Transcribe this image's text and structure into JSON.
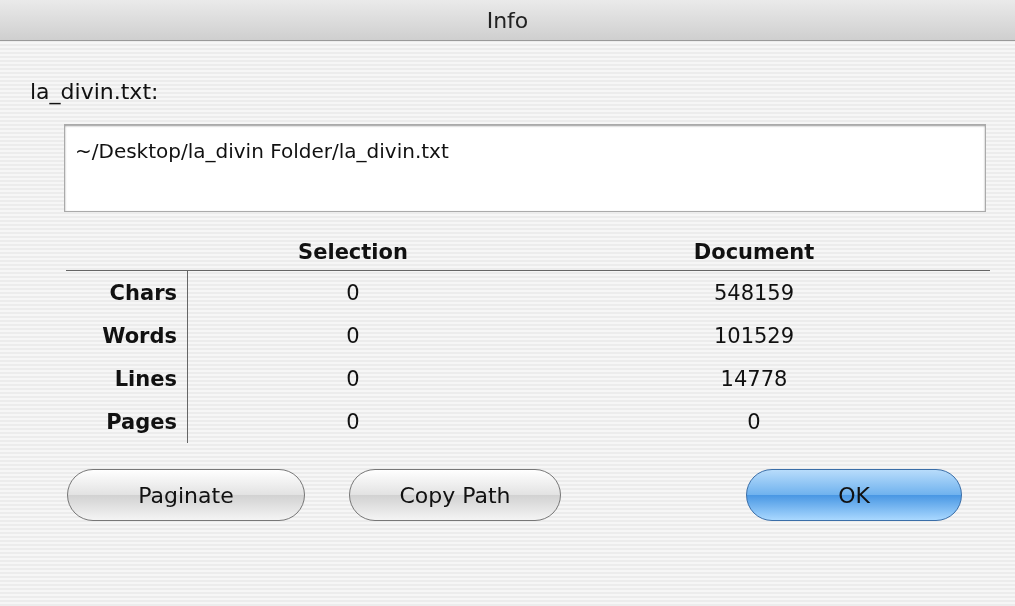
{
  "window": {
    "title": "Info"
  },
  "file_label": "la_divin.txt:",
  "path_field": {
    "value": "~/Desktop/la_divin Folder/la_divin.txt"
  },
  "table": {
    "columns": [
      "Selection",
      "Document"
    ],
    "rows": [
      {
        "label": "Chars",
        "selection": "0",
        "document": "548159"
      },
      {
        "label": "Words",
        "selection": "0",
        "document": "101529"
      },
      {
        "label": "Lines",
        "selection": "0",
        "document": "14778"
      },
      {
        "label": "Pages",
        "selection": "0",
        "document": "0"
      }
    ]
  },
  "buttons": [
    {
      "label": "Paginate",
      "kind": "plain"
    },
    {
      "label": "Copy Path",
      "kind": "plain"
    },
    {
      "label": "OK",
      "kind": "default"
    }
  ]
}
